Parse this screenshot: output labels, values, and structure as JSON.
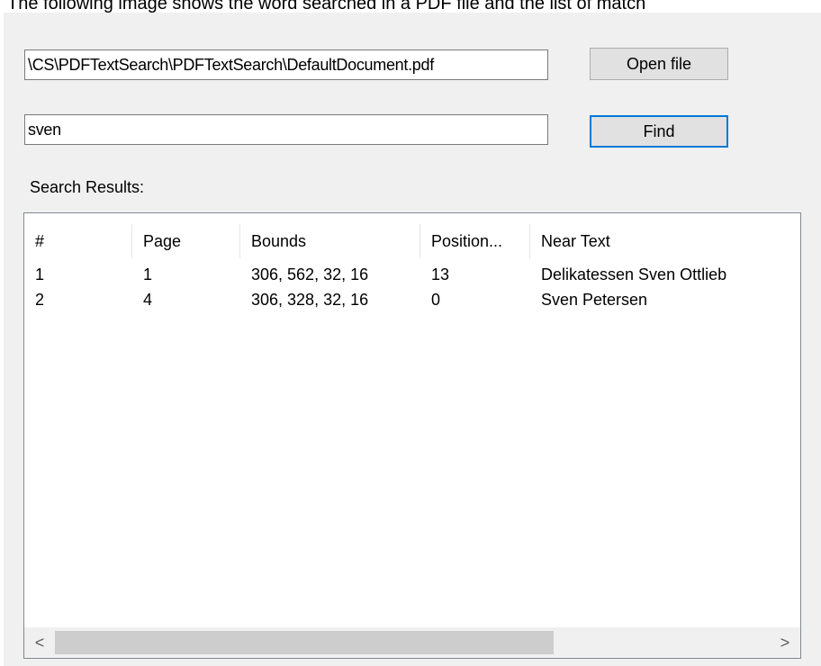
{
  "caption": "The following image shows the word searched in a PDF file and the list of match",
  "file_path": "\\CS\\PDFTextSearch\\PDFTextSearch\\DefaultDocument.pdf",
  "open_file_label": "Open file",
  "search_text": "sven",
  "find_label": "Find",
  "results_label": "Search Results:",
  "columns": [
    "#",
    "Page",
    "Bounds",
    "Position...",
    "Near Text"
  ],
  "rows": [
    [
      "1",
      "1",
      "306, 562, 32, 16",
      "13",
      "Delikatessen Sven Ottlieb"
    ],
    [
      "2",
      "4",
      "306, 328, 32, 16",
      "0",
      "Sven Petersen"
    ]
  ],
  "scroll_left_glyph": "<",
  "scroll_right_glyph": ">",
  "colors": {
    "window_bg": "#f0f0f0",
    "focus_border": "#0078d7"
  }
}
